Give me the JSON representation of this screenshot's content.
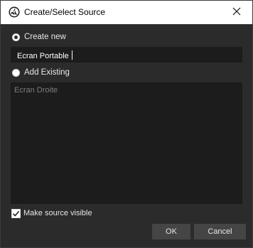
{
  "window": {
    "title": "Create/Select Source"
  },
  "icons": {
    "app": "obs-logo-icon",
    "close": "close-icon",
    "check": "checkmark-icon"
  },
  "options": {
    "create_new": {
      "label": "Create new",
      "selected": true
    },
    "add_existing": {
      "label": "Add Existing",
      "selected": false
    }
  },
  "new_source_name": {
    "value": "Ecran Portable"
  },
  "existing_sources": {
    "items": [
      "Ecran Droite"
    ]
  },
  "make_visible": {
    "label": "Make source visible",
    "checked": true
  },
  "buttons": {
    "ok": "OK",
    "cancel": "Cancel"
  },
  "colors": {
    "background": "#2b2b2b",
    "field": "#1c1c1c",
    "button": "#454545",
    "text": "#e6e6e6",
    "disabled_text": "#7d7d7d"
  }
}
